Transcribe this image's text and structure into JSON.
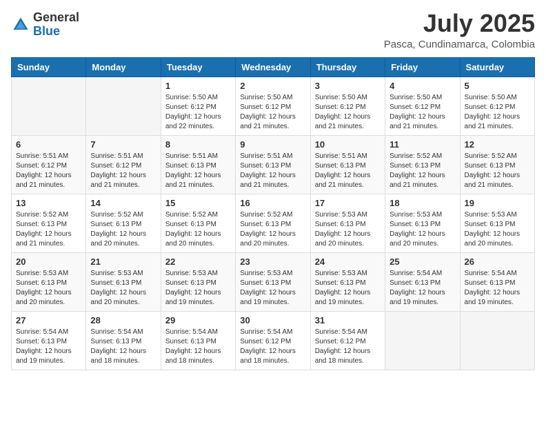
{
  "logo": {
    "general": "General",
    "blue": "Blue"
  },
  "title": {
    "month_year": "July 2025",
    "location": "Pasca, Cundinamarca, Colombia"
  },
  "weekdays": [
    "Sunday",
    "Monday",
    "Tuesday",
    "Wednesday",
    "Thursday",
    "Friday",
    "Saturday"
  ],
  "weeks": [
    [
      {
        "day": "",
        "sunrise": "",
        "sunset": "",
        "daylight": ""
      },
      {
        "day": "",
        "sunrise": "",
        "sunset": "",
        "daylight": ""
      },
      {
        "day": "1",
        "sunrise": "Sunrise: 5:50 AM",
        "sunset": "Sunset: 6:12 PM",
        "daylight": "Daylight: 12 hours and 22 minutes."
      },
      {
        "day": "2",
        "sunrise": "Sunrise: 5:50 AM",
        "sunset": "Sunset: 6:12 PM",
        "daylight": "Daylight: 12 hours and 21 minutes."
      },
      {
        "day": "3",
        "sunrise": "Sunrise: 5:50 AM",
        "sunset": "Sunset: 6:12 PM",
        "daylight": "Daylight: 12 hours and 21 minutes."
      },
      {
        "day": "4",
        "sunrise": "Sunrise: 5:50 AM",
        "sunset": "Sunset: 6:12 PM",
        "daylight": "Daylight: 12 hours and 21 minutes."
      },
      {
        "day": "5",
        "sunrise": "Sunrise: 5:50 AM",
        "sunset": "Sunset: 6:12 PM",
        "daylight": "Daylight: 12 hours and 21 minutes."
      }
    ],
    [
      {
        "day": "6",
        "sunrise": "Sunrise: 5:51 AM",
        "sunset": "Sunset: 6:12 PM",
        "daylight": "Daylight: 12 hours and 21 minutes."
      },
      {
        "day": "7",
        "sunrise": "Sunrise: 5:51 AM",
        "sunset": "Sunset: 6:12 PM",
        "daylight": "Daylight: 12 hours and 21 minutes."
      },
      {
        "day": "8",
        "sunrise": "Sunrise: 5:51 AM",
        "sunset": "Sunset: 6:13 PM",
        "daylight": "Daylight: 12 hours and 21 minutes."
      },
      {
        "day": "9",
        "sunrise": "Sunrise: 5:51 AM",
        "sunset": "Sunset: 6:13 PM",
        "daylight": "Daylight: 12 hours and 21 minutes."
      },
      {
        "day": "10",
        "sunrise": "Sunrise: 5:51 AM",
        "sunset": "Sunset: 6:13 PM",
        "daylight": "Daylight: 12 hours and 21 minutes."
      },
      {
        "day": "11",
        "sunrise": "Sunrise: 5:52 AM",
        "sunset": "Sunset: 6:13 PM",
        "daylight": "Daylight: 12 hours and 21 minutes."
      },
      {
        "day": "12",
        "sunrise": "Sunrise: 5:52 AM",
        "sunset": "Sunset: 6:13 PM",
        "daylight": "Daylight: 12 hours and 21 minutes."
      }
    ],
    [
      {
        "day": "13",
        "sunrise": "Sunrise: 5:52 AM",
        "sunset": "Sunset: 6:13 PM",
        "daylight": "Daylight: 12 hours and 21 minutes."
      },
      {
        "day": "14",
        "sunrise": "Sunrise: 5:52 AM",
        "sunset": "Sunset: 6:13 PM",
        "daylight": "Daylight: 12 hours and 20 minutes."
      },
      {
        "day": "15",
        "sunrise": "Sunrise: 5:52 AM",
        "sunset": "Sunset: 6:13 PM",
        "daylight": "Daylight: 12 hours and 20 minutes."
      },
      {
        "day": "16",
        "sunrise": "Sunrise: 5:52 AM",
        "sunset": "Sunset: 6:13 PM",
        "daylight": "Daylight: 12 hours and 20 minutes."
      },
      {
        "day": "17",
        "sunrise": "Sunrise: 5:53 AM",
        "sunset": "Sunset: 6:13 PM",
        "daylight": "Daylight: 12 hours and 20 minutes."
      },
      {
        "day": "18",
        "sunrise": "Sunrise: 5:53 AM",
        "sunset": "Sunset: 6:13 PM",
        "daylight": "Daylight: 12 hours and 20 minutes."
      },
      {
        "day": "19",
        "sunrise": "Sunrise: 5:53 AM",
        "sunset": "Sunset: 6:13 PM",
        "daylight": "Daylight: 12 hours and 20 minutes."
      }
    ],
    [
      {
        "day": "20",
        "sunrise": "Sunrise: 5:53 AM",
        "sunset": "Sunset: 6:13 PM",
        "daylight": "Daylight: 12 hours and 20 minutes."
      },
      {
        "day": "21",
        "sunrise": "Sunrise: 5:53 AM",
        "sunset": "Sunset: 6:13 PM",
        "daylight": "Daylight: 12 hours and 20 minutes."
      },
      {
        "day": "22",
        "sunrise": "Sunrise: 5:53 AM",
        "sunset": "Sunset: 6:13 PM",
        "daylight": "Daylight: 12 hours and 19 minutes."
      },
      {
        "day": "23",
        "sunrise": "Sunrise: 5:53 AM",
        "sunset": "Sunset: 6:13 PM",
        "daylight": "Daylight: 12 hours and 19 minutes."
      },
      {
        "day": "24",
        "sunrise": "Sunrise: 5:53 AM",
        "sunset": "Sunset: 6:13 PM",
        "daylight": "Daylight: 12 hours and 19 minutes."
      },
      {
        "day": "25",
        "sunrise": "Sunrise: 5:54 AM",
        "sunset": "Sunset: 6:13 PM",
        "daylight": "Daylight: 12 hours and 19 minutes."
      },
      {
        "day": "26",
        "sunrise": "Sunrise: 5:54 AM",
        "sunset": "Sunset: 6:13 PM",
        "daylight": "Daylight: 12 hours and 19 minutes."
      }
    ],
    [
      {
        "day": "27",
        "sunrise": "Sunrise: 5:54 AM",
        "sunset": "Sunset: 6:13 PM",
        "daylight": "Daylight: 12 hours and 19 minutes."
      },
      {
        "day": "28",
        "sunrise": "Sunrise: 5:54 AM",
        "sunset": "Sunset: 6:13 PM",
        "daylight": "Daylight: 12 hours and 18 minutes."
      },
      {
        "day": "29",
        "sunrise": "Sunrise: 5:54 AM",
        "sunset": "Sunset: 6:13 PM",
        "daylight": "Daylight: 12 hours and 18 minutes."
      },
      {
        "day": "30",
        "sunrise": "Sunrise: 5:54 AM",
        "sunset": "Sunset: 6:12 PM",
        "daylight": "Daylight: 12 hours and 18 minutes."
      },
      {
        "day": "31",
        "sunrise": "Sunrise: 5:54 AM",
        "sunset": "Sunset: 6:12 PM",
        "daylight": "Daylight: 12 hours and 18 minutes."
      },
      {
        "day": "",
        "sunrise": "",
        "sunset": "",
        "daylight": ""
      },
      {
        "day": "",
        "sunrise": "",
        "sunset": "",
        "daylight": ""
      }
    ]
  ]
}
